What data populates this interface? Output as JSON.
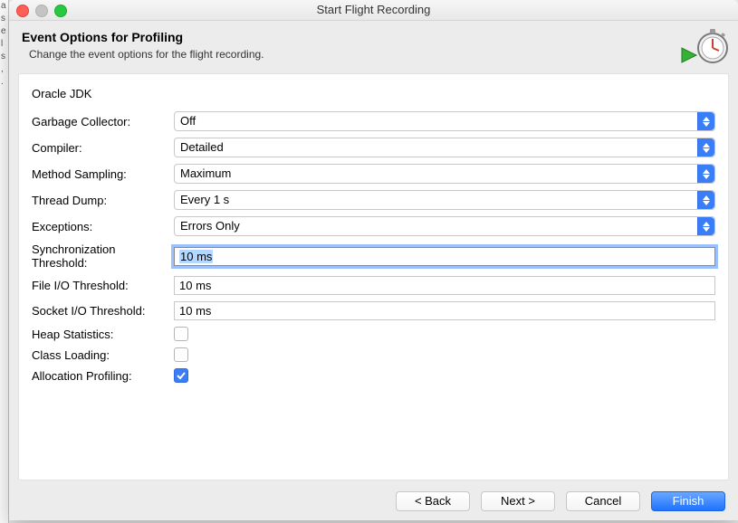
{
  "window": {
    "title": "Start Flight Recording"
  },
  "header": {
    "title": "Event Options for Profiling",
    "subtitle": "Change the event options for the flight recording."
  },
  "section": {
    "title": "Oracle JDK"
  },
  "fields": {
    "gc": {
      "label": "Garbage Collector:",
      "value": "Off"
    },
    "compiler": {
      "label": "Compiler:",
      "value": "Detailed"
    },
    "method_sampling": {
      "label": "Method Sampling:",
      "value": "Maximum"
    },
    "thread_dump": {
      "label": "Thread Dump:",
      "value": "Every 1 s"
    },
    "exceptions": {
      "label": "Exceptions:",
      "value": "Errors Only"
    },
    "sync_threshold": {
      "label": "Synchronization Threshold:",
      "value": "10 ms"
    },
    "file_io_threshold": {
      "label": "File I/O Threshold:",
      "value": "10 ms"
    },
    "socket_io_threshold": {
      "label": "Socket I/O Threshold:",
      "value": "10 ms"
    },
    "heap_stats": {
      "label": "Heap Statistics:",
      "checked": false
    },
    "class_loading": {
      "label": "Class Loading:",
      "checked": false
    },
    "allocation_profiling": {
      "label": "Allocation Profiling:",
      "checked": true
    }
  },
  "buttons": {
    "back": "< Back",
    "next": "Next >",
    "cancel": "Cancel",
    "finish": "Finish"
  }
}
